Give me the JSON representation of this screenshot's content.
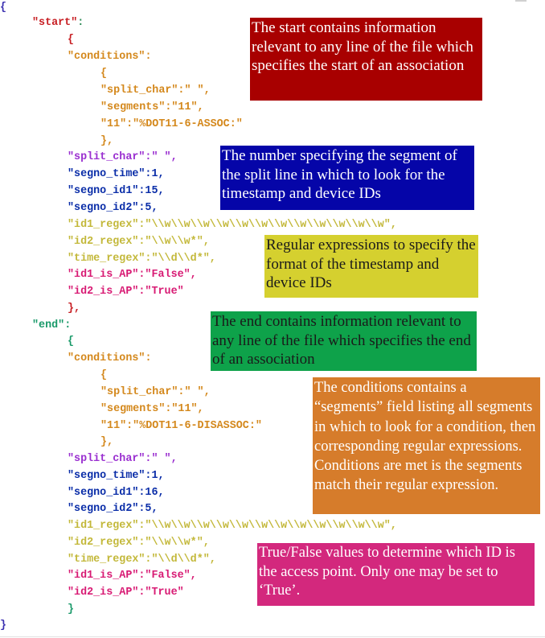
{
  "code": {
    "open_brace": "{",
    "close_brace": "}",
    "start_key": "\"start\"",
    "end_key": "\"end\"",
    "colon": ":",
    "start": {
      "open": "{",
      "close": "},",
      "conditions_key": "\"conditions\"",
      "cond_open": "{",
      "cond_close": "},",
      "cond_split_char": "\"split_char\":\" \",",
      "cond_segments": "\"segments\":\"11\",",
      "cond_11": "\"11\":\"%DOT11-6-ASSOC:\"",
      "split_char": "\"split_char\":\" \",",
      "segno_time": "\"segno_time\":1,",
      "segno_id1": "\"segno_id1\":15,",
      "segno_id2": "\"segno_id2\":5,",
      "id1_regex": "\"id1_regex\":\"\\\\w\\\\w\\\\w\\\\w\\\\w\\\\w\\\\w\\\\w\\\\w\\\\w\\\\w\\\\w\",",
      "id2_regex": "\"id2_regex\":\"\\\\w\\\\w*\",",
      "time_regex": "\"time_regex\":\"\\\\d\\\\d*\",",
      "id1_is_ap": "\"id1_is_AP\":\"False\",",
      "id2_is_ap": "\"id2_is_AP\":\"True\""
    },
    "end": {
      "open": "{",
      "close": "}",
      "conditions_key": "\"conditions\"",
      "cond_open": "{",
      "cond_close": "},",
      "cond_split_char": "\"split_char\":\" \",",
      "cond_segments": "\"segments\":\"11\",",
      "cond_11": "\"11\":\"%DOT11-6-DISASSOC:\"",
      "split_char": "\"split_char\":\" \",",
      "segno_time": "\"segno_time\":1,",
      "segno_id1": "\"segno_id1\":16,",
      "segno_id2": "\"segno_id2\":5,",
      "id1_regex": "\"id1_regex\":\"\\\\w\\\\w\\\\w\\\\w\\\\w\\\\w\\\\w\\\\w\\\\w\\\\w\\\\w\\\\w\",",
      "id2_regex": "\"id2_regex\":\"\\\\w\\\\w*\",",
      "time_regex": "\"time_regex\":\"\\\\d\\\\d*\",",
      "id1_is_ap": "\"id1_is_AP\":\"False\",",
      "id2_is_ap": "\"id2_is_AP\":\"True\""
    }
  },
  "notes": {
    "start": "The start contains information relevant to any line of the file which specifies the start of an association",
    "segment_number": "The number specifying the segment of the split line in which to look for the timestamp and device IDs",
    "regex": "Regular expressions to specify the format of the timestamp and device IDs",
    "end": "The end contains information relevant to any line of the file which specifies the end of an association",
    "conditions": "The conditions contains a “segments” field listing all segments in which to look for a condition, then corresponding regular expressions. Conditions are met is the segments match their regular expression.",
    "boolean": "True/False values to determine which ID is the access point. Only one may be set to ‘True’."
  },
  "colors": {
    "start_note": "#a80000",
    "segment_note": "#0505a8",
    "regex_note": "#d5d02f",
    "end_note": "#0ea24a",
    "conditions_note": "#d67c2b",
    "boolean_note": "#d3287d"
  }
}
